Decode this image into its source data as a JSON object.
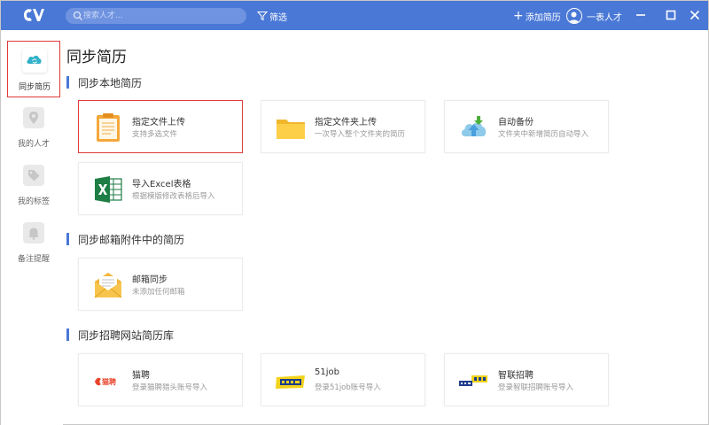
{
  "topbar": {
    "search_placeholder": "搜索人才...",
    "filter_label": "筛选",
    "add_resume_label": "添加简历",
    "user_name": "一表人才",
    "accent_color": "#4a78d6"
  },
  "sidebar": {
    "items": [
      {
        "label": "同步简历",
        "icon": "cloud-sync-icon",
        "active": true
      },
      {
        "label": "我的人才",
        "icon": "location-pin-icon",
        "active": false
      },
      {
        "label": "我的标签",
        "icon": "tag-icon",
        "active": false
      },
      {
        "label": "备注提醒",
        "icon": "bell-icon",
        "active": false
      }
    ]
  },
  "main": {
    "title": "同步简历",
    "sections": [
      {
        "title": "同步本地简历",
        "cards": [
          {
            "title": "指定文件上传",
            "subtitle": "支持多选文件",
            "icon": "document-icon",
            "selected": true
          },
          {
            "title": "指定文件夹上传",
            "subtitle": "一次导入整个文件夹的简历",
            "icon": "folder-icon",
            "selected": false
          },
          {
            "title": "自动备份",
            "subtitle": "文件夹中新增简历自动导入",
            "icon": "cloud-upload-icon",
            "selected": false
          },
          {
            "title": "导入Excel表格",
            "subtitle": "根据模版修改表格后导入",
            "icon": "excel-icon",
            "selected": false
          }
        ]
      },
      {
        "title": "同步邮箱附件中的简历",
        "cards": [
          {
            "title": "邮箱同步",
            "subtitle": "未添加任何邮箱",
            "icon": "envelope-icon",
            "selected": false
          }
        ]
      },
      {
        "title": "同步招聘网站简历库",
        "cards": [
          {
            "title": "猫聘",
            "subtitle": "登录猫聘猎头账号导入",
            "icon": "maopin-logo-icon",
            "logo_text": "猫聘",
            "selected": false
          },
          {
            "title": "51job",
            "subtitle": "登录51job账号导入",
            "icon": "51job-logo-icon",
            "selected": false
          },
          {
            "title": "智联招聘",
            "subtitle": "登录智联招聘账号导入",
            "icon": "zhaopin-logo-icon",
            "selected": false
          }
        ]
      }
    ]
  }
}
